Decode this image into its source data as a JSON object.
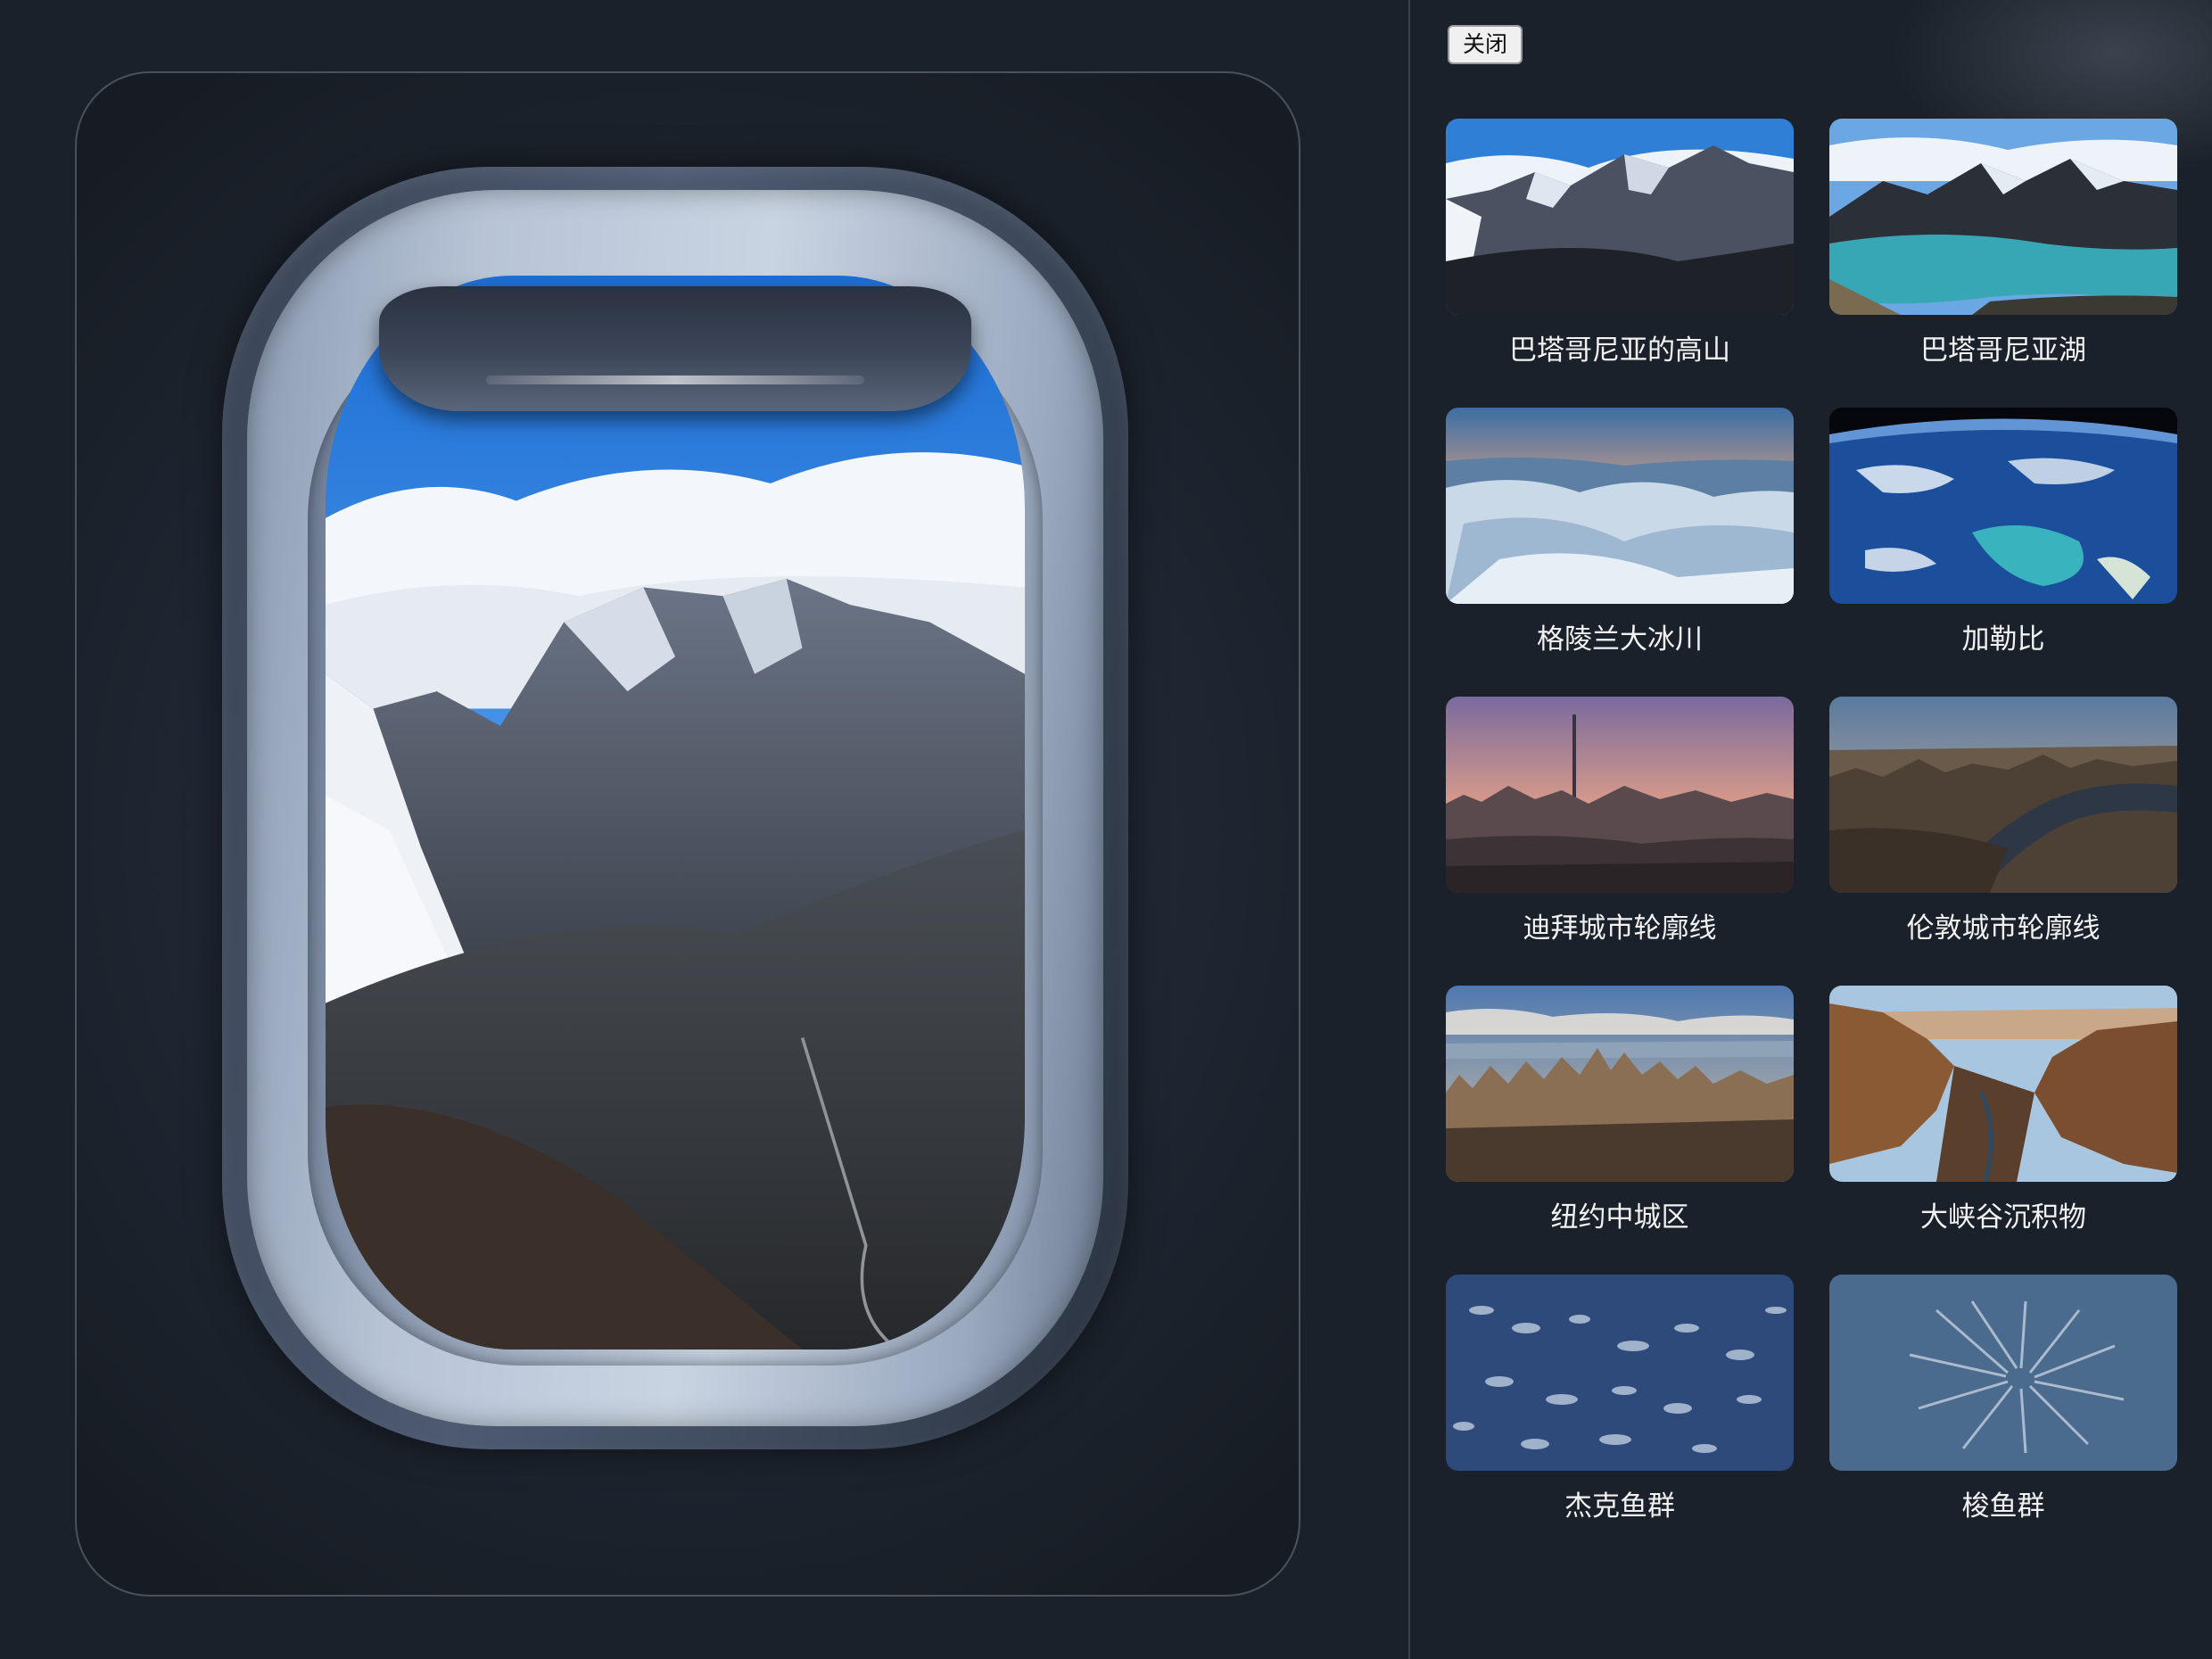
{
  "close_button": {
    "label": "关闭",
    "icon": "close"
  },
  "scenes": [
    {
      "title": "巴塔哥尼亚的高山",
      "theme": "mountains"
    },
    {
      "title": "巴塔哥尼亚湖",
      "theme": "lake"
    },
    {
      "title": "格陵兰大冰川",
      "theme": "glacier"
    },
    {
      "title": "加勒比",
      "theme": "earth"
    },
    {
      "title": "迪拜城市轮廓线",
      "theme": "city-dusk"
    },
    {
      "title": "伦敦城市轮廓线",
      "theme": "city-river"
    },
    {
      "title": "纽约中城区",
      "theme": "city-day"
    },
    {
      "title": "大峡谷沉积物",
      "theme": "canyon"
    },
    {
      "title": "杰克鱼群",
      "theme": "fish"
    },
    {
      "title": "梭鱼群",
      "theme": "fish-light"
    }
  ],
  "colors": {
    "background": "#1b212a",
    "label": "#f2f2f2",
    "button_bg": "#f0f0f0"
  }
}
